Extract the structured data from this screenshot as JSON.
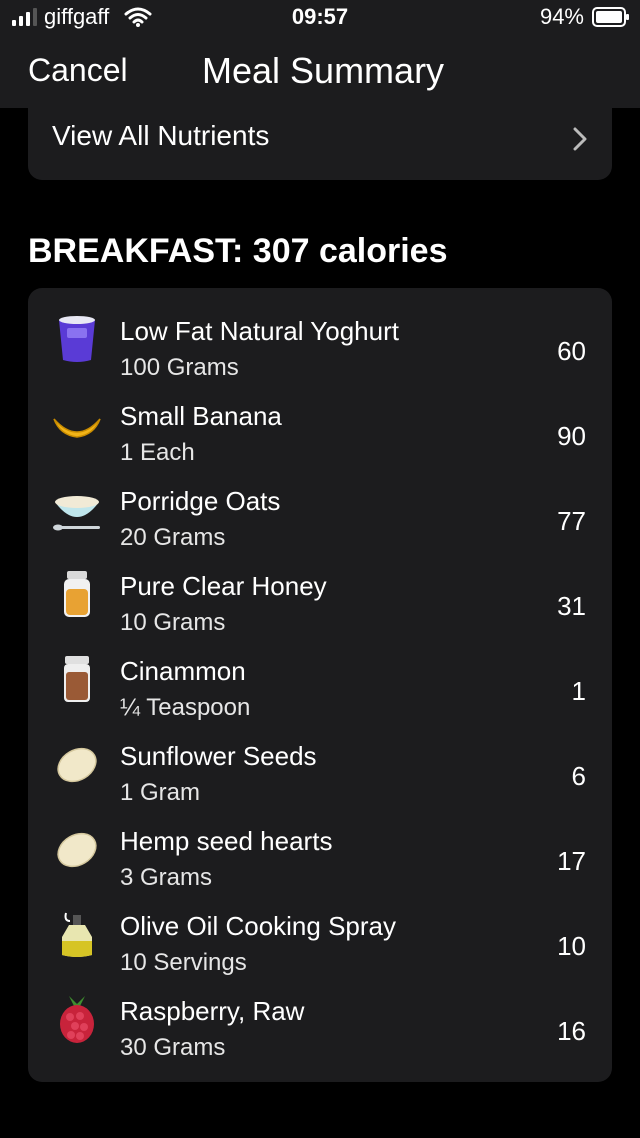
{
  "status_bar": {
    "carrier": "giffgaff",
    "time": "09:57",
    "battery": "94%",
    "icons": [
      "signal-icon",
      "wifi-icon",
      "battery-icon"
    ]
  },
  "nav": {
    "cancel_label": "Cancel",
    "title": "Meal Summary"
  },
  "nutrients": {
    "label": "View All Nutrients",
    "icon": "chevron-right-icon"
  },
  "section": {
    "heading": "BREAKFAST: 307 calories"
  },
  "foods": [
    {
      "name": "Low Fat Natural Yoghurt",
      "quantity": "100 Grams",
      "calories": "60",
      "icon": "yoghurt-icon"
    },
    {
      "name": "Small Banana",
      "quantity": "1 Each",
      "calories": "90",
      "icon": "banana-icon"
    },
    {
      "name": "Porridge Oats",
      "quantity": "20 Grams",
      "calories": "77",
      "icon": "oats-bowl-icon"
    },
    {
      "name": "Pure Clear Honey",
      "quantity": "10 Grams",
      "calories": "31",
      "icon": "honey-jar-icon"
    },
    {
      "name": "Cinammon",
      "quantity": "¼ Teaspoon",
      "calories": "1",
      "icon": "spice-jar-icon"
    },
    {
      "name": "Sunflower Seeds",
      "quantity": "1 Gram",
      "calories": "6",
      "icon": "seed-icon"
    },
    {
      "name": "Hemp seed hearts",
      "quantity": "3 Grams",
      "calories": "17",
      "icon": "seed-icon"
    },
    {
      "name": "Olive Oil Cooking Spray",
      "quantity": "10 Servings",
      "calories": "10",
      "icon": "olive-oil-icon"
    },
    {
      "name": "Raspberry, Raw",
      "quantity": "30 Grams",
      "calories": "16",
      "icon": "raspberry-icon"
    }
  ],
  "colors": {
    "background": "#000000",
    "surface": "#1c1c1e",
    "text": "#ffffff"
  }
}
